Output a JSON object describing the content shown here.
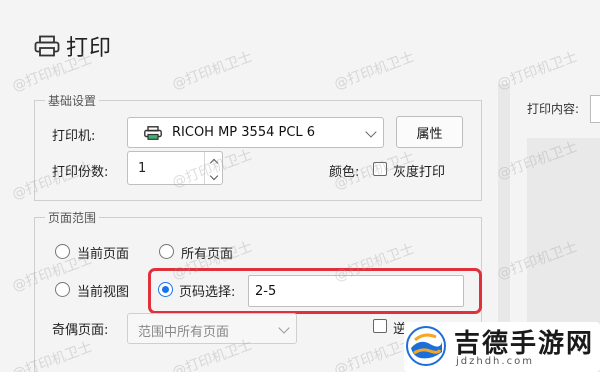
{
  "dialog": {
    "title": "打印"
  },
  "basic": {
    "legend": "基础设置",
    "printer_label": "打印机:",
    "printer_value": "RICOH MP 3554 PCL 6",
    "properties_button": "属性",
    "copies_label": "打印份数:",
    "copies_value": "1",
    "color_label": "颜色:",
    "grayscale_label": "灰度打印",
    "grayscale_checked": false
  },
  "range": {
    "legend": "页面范围",
    "options": [
      {
        "label": "当前页面",
        "selected": false
      },
      {
        "label": "所有页面",
        "selected": false
      },
      {
        "label": "当前视图",
        "selected": false
      },
      {
        "label": "页码选择:",
        "selected": true
      }
    ],
    "page_selection_value": "2-5",
    "odd_even_label": "奇偶页面:",
    "odd_even_value": "范围中所有页面",
    "partial_checkbox_label": "逆"
  },
  "preview": {
    "label": "打印内容:"
  },
  "watermark_text": "@打印机卫士",
  "badge": {
    "brand": "吉德手游网",
    "domain": "jdzhdh.com"
  },
  "colors": {
    "accent": "#1a73e8",
    "highlight": "#e0303b"
  }
}
